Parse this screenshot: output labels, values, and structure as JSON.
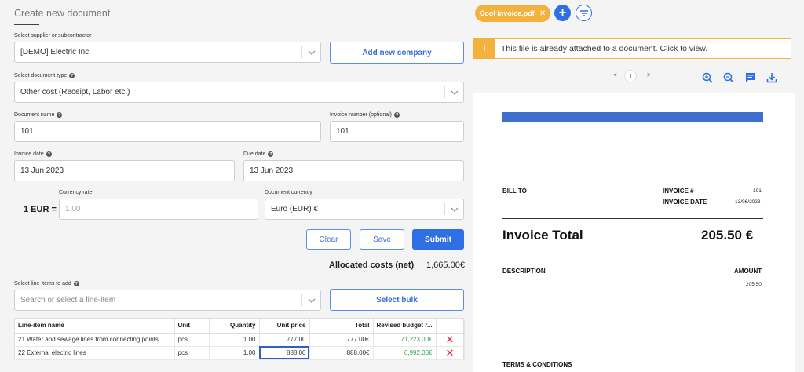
{
  "form": {
    "title": "Create new document",
    "supplier_label": "Select supplier or subcontractor",
    "supplier_value": "[DEMO] Electric Inc.",
    "add_company": "Add new company",
    "doctype_label": "Select document type",
    "doctype_value": "Other cost (Receipt, Labor etc.)",
    "docname_label": "Document name",
    "docname_value": "101",
    "invnum_label": "Invoice number (optional)",
    "invnum_value": "101",
    "invdate_label": "Invoice date",
    "invdate_value": "13 Jun 2023",
    "duedate_label": "Due date",
    "duedate_value": "13 Jun 2023",
    "rate_prefix": "1 EUR =",
    "rate_label": "Currency rate",
    "rate_placeholder": "1.00",
    "currency_label": "Document currency",
    "currency_value": "Euro (EUR) €",
    "clear": "Clear",
    "save": "Save",
    "submit": "Submit",
    "allocated_label": "Allocated costs (net)",
    "allocated_value": "1,665.00€",
    "lineitems_label": "Select line-items to add",
    "lineitems_placeholder": "Search or select a line-item",
    "select_bulk": "Select bulk"
  },
  "table": {
    "headers": [
      "Line-item name",
      "Unit",
      "Quantity",
      "Unit price",
      "Total",
      "Revised budget r..."
    ],
    "rows": [
      {
        "name": "21 Water and sewage lines from connecting points",
        "unit": "pcs",
        "qty": "1.00",
        "price": "777.00",
        "total": "777.00€",
        "budget": "71,223.00€"
      },
      {
        "name": "22 External electric lines",
        "unit": "pcs",
        "qty": "1.00",
        "price": "888.00",
        "total": "888.00€",
        "budget": "6,992.00€"
      }
    ]
  },
  "panel": {
    "file_chip": "Cool invoice.pdf",
    "alert_mark": "!",
    "alert_text": "This file is already attached to a document. Click to view.",
    "prev": "<",
    "page": "1",
    "next": ">"
  },
  "invoice": {
    "bill_to": "BILL TO",
    "invoice_no_label": "INVOICE #",
    "invoice_no": "101",
    "invoice_date_label": "INVOICE DATE",
    "invoice_date": "13/06/2023",
    "total_label": "Invoice Total",
    "total_value": "205.50 €",
    "description": "DESCRIPTION",
    "amount": "AMOUNT",
    "amount_value": "205.50",
    "terms": "TERMS & CONDITIONS"
  },
  "colors": {
    "accent": "#2f6fe4",
    "warning": "#f3b23d",
    "danger": "#e0243a",
    "positive": "#2ea44f"
  }
}
